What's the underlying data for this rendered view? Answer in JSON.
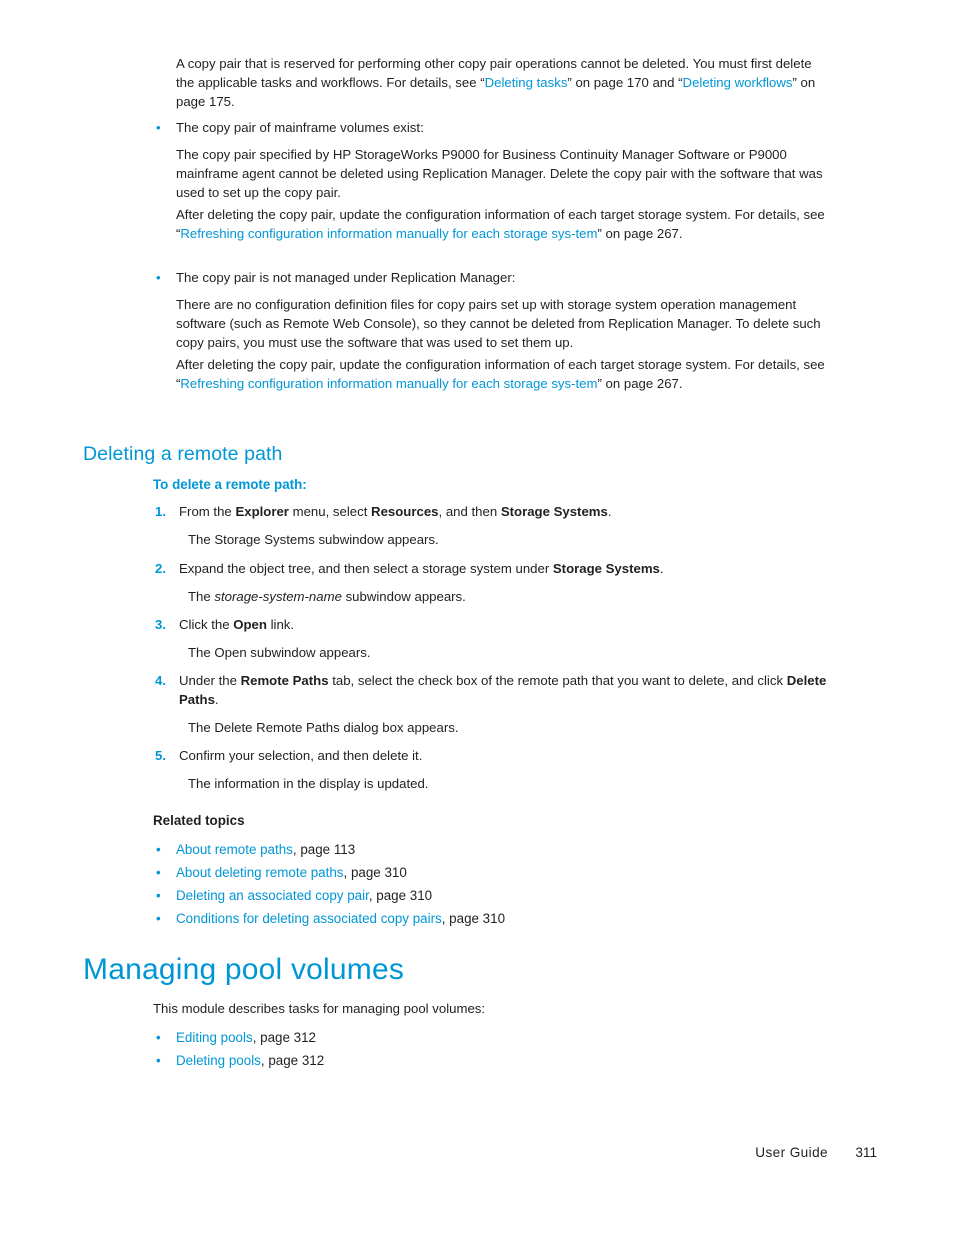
{
  "document": {
    "type": "user-guide-page",
    "accent_color": "#0096d6",
    "text_color": "#231f20",
    "background": "#ffffff"
  },
  "intro": {
    "paragraph_part1": "A copy pair that is reserved for performing other copy pair operations cannot be deleted. You must first delete the applicable tasks and workflows. For details, see “",
    "link1": "Deleting tasks",
    "paragraph_part2": "” on page 170 and “",
    "link2": "Deleting workflows",
    "paragraph_part3": "” on page 175."
  },
  "conditions": {
    "bullet_marker": "•",
    "items": [
      {
        "lead": "The copy pair of mainframe volumes exist:",
        "paragraphs": [
          {
            "text": "The copy pair specified by HP StorageWorks P9000 for Business Continuity Manager Software or P9000 mainframe agent cannot be deleted using Replication Manager. Delete the copy pair with the software that was used to set up the copy pair."
          },
          {
            "before": "After deleting the copy pair, update the configuration information of each target storage system. For details, see “",
            "link": "Refreshing configuration information manually for each storage sys-tem",
            "after": "” on page 267."
          }
        ]
      },
      {
        "lead": "The copy pair is not managed under Replication Manager:",
        "paragraphs": [
          {
            "text": "There are no configuration definition files for copy pairs set up with storage system operation management software (such as Remote Web Console), so they cannot be deleted from Replication Manager. To delete such copy pairs, you must use the software that was used to set them up."
          },
          {
            "before": "After deleting the copy pair, update the configuration information of each target storage system. For details, see “",
            "link": "Refreshing configuration information manually for each storage sys-tem",
            "after": "” on page 267."
          }
        ]
      }
    ]
  },
  "section_remote_path": {
    "heading": "Deleting a remote path",
    "procedure_title": "To delete a remote path:",
    "steps": [
      {
        "number": "1.",
        "t1": "From the ",
        "b1": "Explorer",
        "t2": " menu, select ",
        "b2": "Resources",
        "t3": ", and then ",
        "b3": "Storage Systems",
        "t4": ".",
        "result": "The Storage Systems subwindow appears."
      },
      {
        "number": "2.",
        "t1": "Expand the object tree, and then select a storage system under ",
        "b1": "Storage Systems",
        "t2": ".",
        "result_before": "The ",
        "result_italic": "storage-system-name",
        "result_after": " subwindow appears."
      },
      {
        "number": "3.",
        "t1": "Click the ",
        "b1": "Open",
        "t2": " link.",
        "result": "The Open subwindow appears."
      },
      {
        "number": "4.",
        "t1": "Under the ",
        "b1": "Remote Paths",
        "t2": " tab, select the check box of the remote path that you want to delete, and click ",
        "b2": "Delete Paths",
        "t3": ".",
        "result": "The Delete Remote Paths dialog box appears."
      },
      {
        "number": "5.",
        "t1": "Confirm your selection, and then delete it.",
        "result": "The information in the display is updated."
      }
    ],
    "related_title": "Related topics",
    "related_marker": "•",
    "related_topics": [
      {
        "link": "About remote paths",
        "page": ", page 113"
      },
      {
        "link": "About deleting remote paths",
        "page": ", page 310"
      },
      {
        "link": "Deleting an associated copy pair",
        "page": ", page 310"
      },
      {
        "link": "Conditions for deleting associated copy pairs",
        "page": ", page 310"
      }
    ]
  },
  "section_pool_volumes": {
    "heading": "Managing pool volumes",
    "intro": "This module describes tasks for managing pool volumes:",
    "marker": "•",
    "topics": [
      {
        "link": "Editing pools",
        "page": ", page 312"
      },
      {
        "link": "Deleting pools",
        "page": ", page 312"
      }
    ]
  },
  "footer": {
    "label": "User Guide",
    "page_number": "311"
  }
}
